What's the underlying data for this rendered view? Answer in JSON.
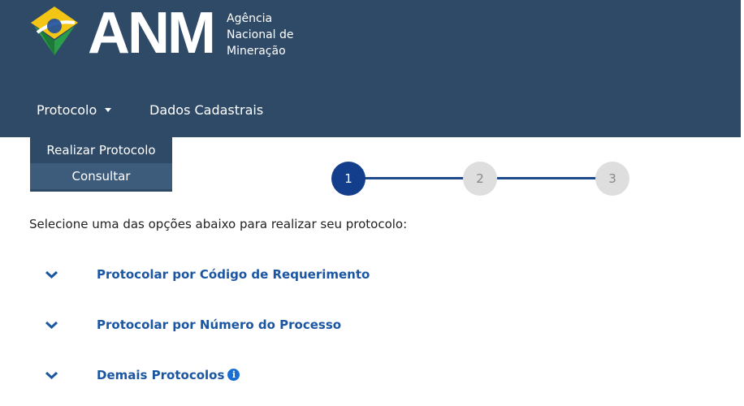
{
  "header": {
    "logo_text": "ANM",
    "logo_sub": [
      "Agência",
      "Nacional de",
      "Mineração"
    ],
    "colors": {
      "bar": "#2f4a67",
      "accent": "#1b56a3"
    }
  },
  "nav": {
    "items": [
      {
        "label": "Protocolo",
        "icon": "caret-down-icon"
      },
      {
        "label": "Dados Cadastrais"
      }
    ],
    "dropdown": [
      "Realizar Protocolo",
      "Consultar"
    ]
  },
  "steps": [
    "1",
    "2",
    "3"
  ],
  "main": {
    "intro": "Selecione uma das opções abaixo para realizar seu protocolo:",
    "options": [
      {
        "label": "Protocolar por Código de Requerimento",
        "icon": "chevron-down-icon"
      },
      {
        "label": "Protocolar por Número do Processo",
        "icon": "chevron-down-icon"
      },
      {
        "label": "Demais Protocolos",
        "icon": "chevron-down-icon",
        "info_icon": "info-icon"
      }
    ]
  }
}
